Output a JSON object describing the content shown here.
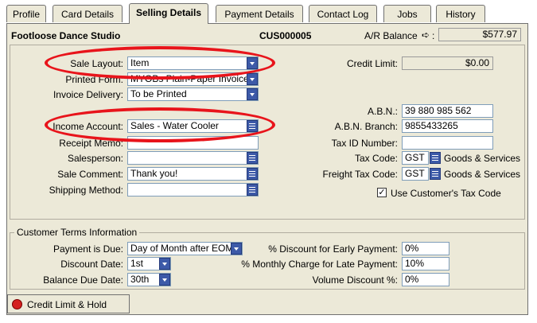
{
  "tabs": [
    "Profile",
    "Card Details",
    "Selling Details",
    "Payment Details",
    "Contact Log",
    "Jobs",
    "History"
  ],
  "header": {
    "company": "Footloose Dance Studio",
    "card_id": "CUS000005",
    "ar_label": "A/R Balance",
    "ar_value": "$577.97"
  },
  "left": {
    "sale_layout": {
      "label": "Sale Layout:",
      "value": "Item"
    },
    "printed_form": {
      "label": "Printed Form:",
      "value": "MYOBs Plain-Paper Invoice"
    },
    "invoice_delivery": {
      "label": "Invoice Delivery:",
      "value": "To be Printed"
    },
    "income_account": {
      "label": "Income Account:",
      "value": "Sales - Water Cooler"
    },
    "receipt_memo": {
      "label": "Receipt Memo:",
      "value": ""
    },
    "salesperson": {
      "label": "Salesperson:",
      "value": ""
    },
    "sale_comment": {
      "label": "Sale Comment:",
      "value": "Thank you!"
    },
    "shipping_method": {
      "label": "Shipping Method:",
      "value": ""
    }
  },
  "right": {
    "credit_limit": {
      "label": "Credit Limit:",
      "value": "$0.00"
    },
    "abn": {
      "label": "A.B.N.:",
      "value": "39 880 985 562"
    },
    "abn_branch": {
      "label": "A.B.N. Branch:",
      "value": "9855433265"
    },
    "tax_id": {
      "label": "Tax ID Number:",
      "value": ""
    },
    "tax_code": {
      "label": "Tax Code:",
      "value": "GST",
      "desc": "Goods & Services"
    },
    "freight_tax_code": {
      "label": "Freight Tax Code:",
      "value": "GST",
      "desc": "Goods & Services"
    },
    "use_customer_tax": {
      "label": "Use Customer's Tax Code",
      "checked": true
    }
  },
  "terms": {
    "title": "Customer Terms Information",
    "payment_due": {
      "label": "Payment is Due:",
      "value": "Day of Month after EOM"
    },
    "discount_date": {
      "label": "Discount Date:",
      "value": "1st"
    },
    "balance_due_date": {
      "label": "Balance Due Date:",
      "value": "30th"
    },
    "early_payment": {
      "label": "% Discount for Early Payment:",
      "value": "0%"
    },
    "late_payment": {
      "label": "% Monthly Charge for Late Payment:",
      "value": "10%"
    },
    "volume_discount": {
      "label": "Volume Discount %:",
      "value": "0%"
    }
  },
  "footer": {
    "credit_hold_label": "Credit Limit & Hold"
  },
  "colors": {
    "panel": "#ece9d8",
    "highlight": "#e8141b",
    "dropdown": "#3d5aa8"
  }
}
